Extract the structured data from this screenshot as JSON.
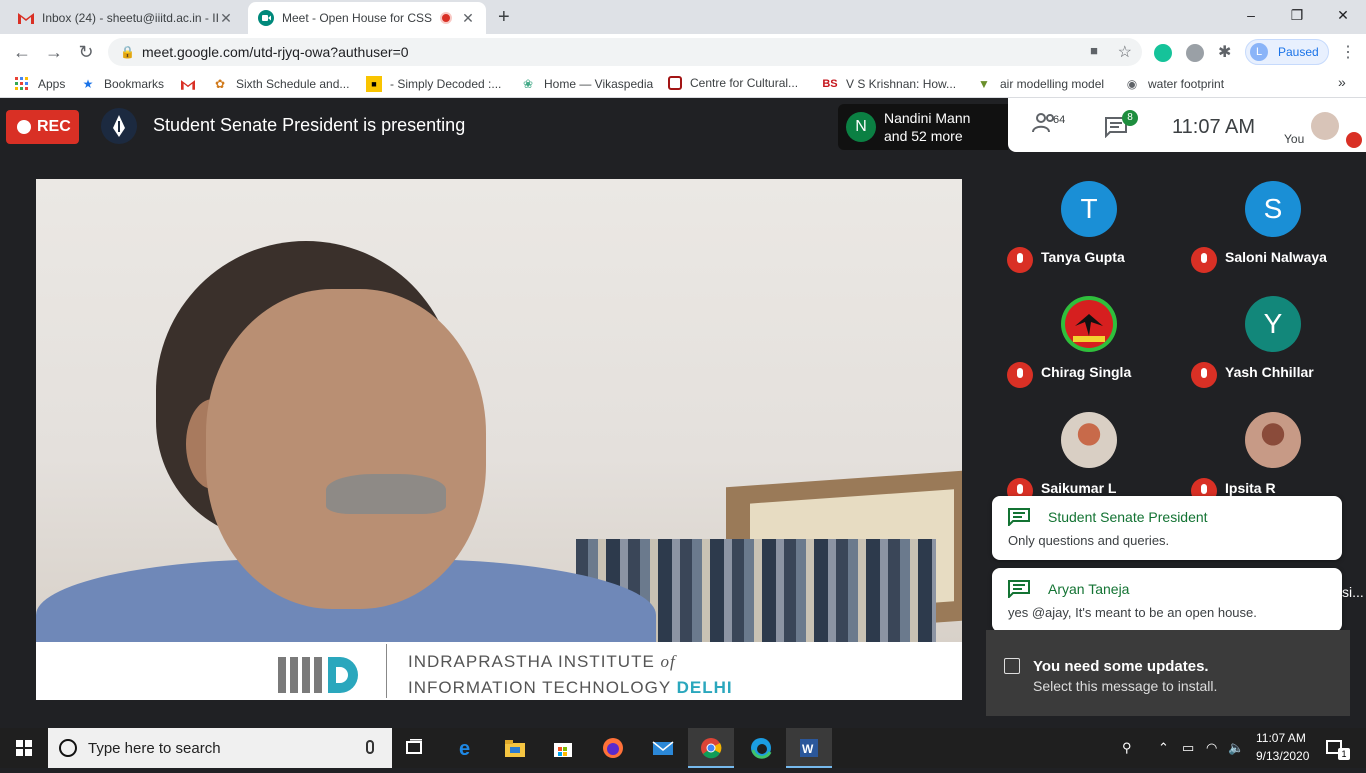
{
  "browser": {
    "tabs": [
      {
        "title": "Inbox (24) - sheetu@iiitd.ac.in - II",
        "icon": "gmail-icon"
      },
      {
        "title": "Meet - Open House for CSSS",
        "icon": "meet-icon",
        "recording": true
      }
    ],
    "new_tab": "+",
    "url": "meet.google.com/utd-rjyq-owa?authuser=0",
    "profile_initial": "L",
    "profile_label": "Paused",
    "bookmarks": [
      {
        "label": "Apps",
        "icon": "apps-grid-icon"
      },
      {
        "label": "Bookmarks",
        "icon": "star-icon"
      },
      {
        "label": "",
        "icon": "gmail-icon"
      },
      {
        "label": "Sixth Schedule and...",
        "icon": "bookmark-icon"
      },
      {
        "label": "- Simply Decoded :...",
        "icon": "bookmark-icon"
      },
      {
        "label": "Home — Vikaspedia",
        "icon": "bookmark-icon"
      },
      {
        "label": "Centre for Cultural...",
        "icon": "bookmark-icon"
      },
      {
        "label": "V S Krishnan: How...",
        "icon": "bookmark-icon",
        "prefix": "BS"
      },
      {
        "label": "air modelling model",
        "icon": "bookmark-icon"
      },
      {
        "label": "water footprint",
        "icon": "globe-icon"
      }
    ],
    "bookmarks_more": "»"
  },
  "meet": {
    "rec_label": "REC",
    "presenting_text": "Student Senate President is presenting",
    "namecard": {
      "initial": "N",
      "line1": "Nandini Mann",
      "line2": "and 52 more"
    },
    "people_count": "64",
    "chat_badge": "8",
    "clock": "11:07  AM",
    "you_label": "You",
    "participants": [
      {
        "name": "Tanya Gupta",
        "initial": "T",
        "color": "#1a8fd6"
      },
      {
        "name": "Saloni Nalwaya",
        "initial": "S",
        "color": "#1a8fd6"
      },
      {
        "name": "Chirag Singla",
        "initial": "",
        "color": "#2fbf3c"
      },
      {
        "name": "Yash Chhillar",
        "initial": "Y",
        "color": "#12877a"
      },
      {
        "name": "Saikumar L",
        "initial": "",
        "color": "#b7a091"
      },
      {
        "name": "Ipsita R",
        "initial": "",
        "color": "#c79a86"
      }
    ],
    "chat_toasts": [
      {
        "from": "Student Senate President",
        "message": "Only questions and queries."
      },
      {
        "from": "Aryan Taneja",
        "message": "yes @ajay, It's meant to be an open house."
      }
    ],
    "edge_fragment": "si...",
    "presentation": {
      "institute_line1": "INDRAPRASTHA INSTITUTE",
      "institute_of": "of",
      "institute_line2": "INFORMATION TECHNOLOGY",
      "institute_city": "DELHI"
    }
  },
  "windows": {
    "notification": {
      "title": "You need some updates.",
      "subtitle": "Select this message to install."
    },
    "search_placeholder": "Type here to search",
    "time": "11:07 AM",
    "date": "9/13/2020",
    "notif_count": "1"
  },
  "colors": {
    "rec": "#d93025",
    "meet_dark": "#202124",
    "accent_green": "#137333",
    "chrome_blue": "#1a73e8"
  }
}
